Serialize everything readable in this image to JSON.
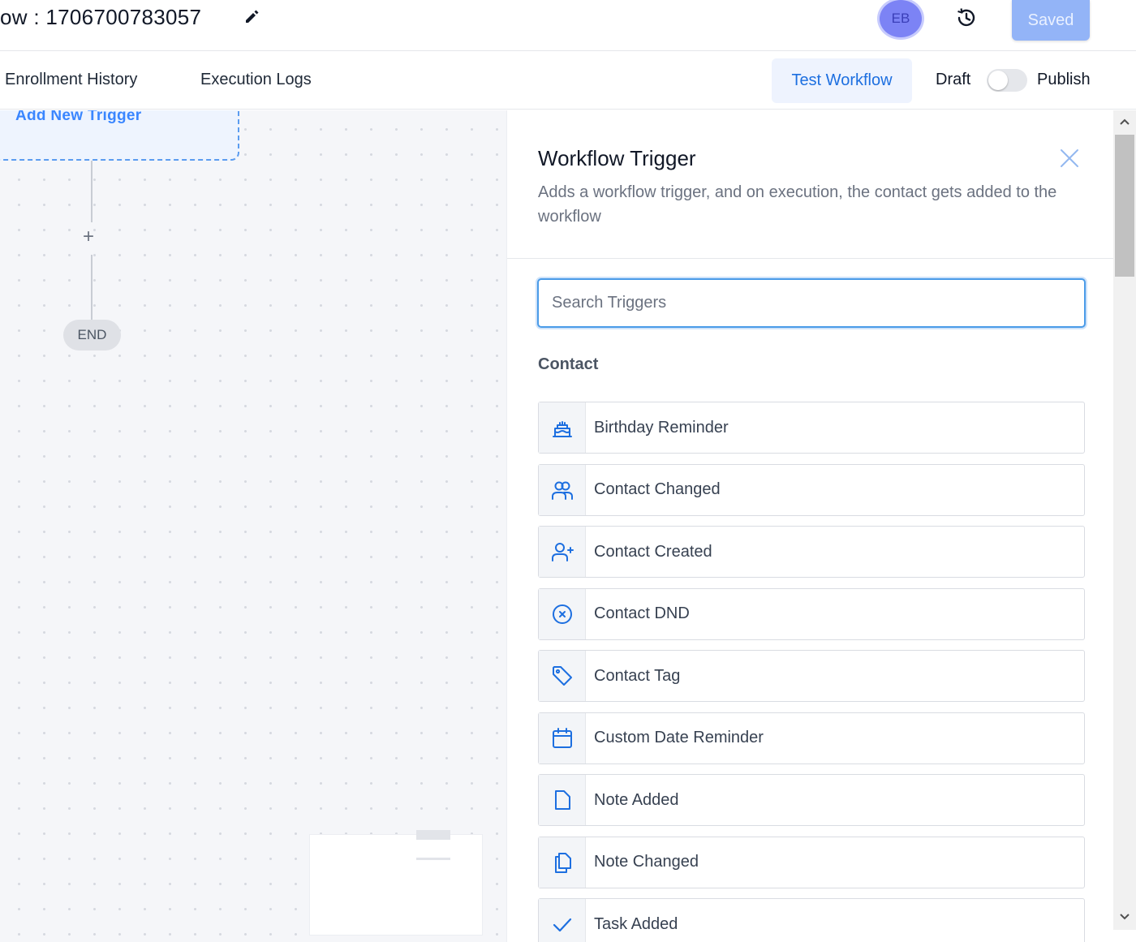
{
  "header": {
    "title": "ow : 1706700783057",
    "avatar_initials": "EB",
    "saved_label": "Saved"
  },
  "nav": {
    "enrollment_history": "Enrollment History",
    "execution_logs": "Execution Logs",
    "test_workflow": "Test Workflow",
    "draft": "Draft",
    "publish": "Publish",
    "publish_toggle_on": false
  },
  "canvas": {
    "trigger_node_label": "Add New Trigger",
    "end_label": "END",
    "add_step_symbol": "+"
  },
  "panel": {
    "title": "Workflow Trigger",
    "description": "Adds a workflow trigger, and on execution, the contact gets added to the workflow",
    "search_placeholder": "Search Triggers",
    "section": "Contact",
    "items": [
      {
        "label": "Birthday Reminder",
        "icon": "cake-icon"
      },
      {
        "label": "Contact Changed",
        "icon": "users-icon"
      },
      {
        "label": "Contact Created",
        "icon": "user-plus-icon"
      },
      {
        "label": "Contact DND",
        "icon": "circle-x-icon"
      },
      {
        "label": "Contact Tag",
        "icon": "tag-icon"
      },
      {
        "label": "Custom Date Reminder",
        "icon": "calendar-icon"
      },
      {
        "label": "Note Added",
        "icon": "file-icon"
      },
      {
        "label": "Note Changed",
        "icon": "files-icon"
      },
      {
        "label": "Task Added",
        "icon": "check-icon"
      }
    ]
  },
  "colors": {
    "accent": "#1d6fe0",
    "icon": "#1d6fe0",
    "saved_button": "#93b4f7"
  }
}
